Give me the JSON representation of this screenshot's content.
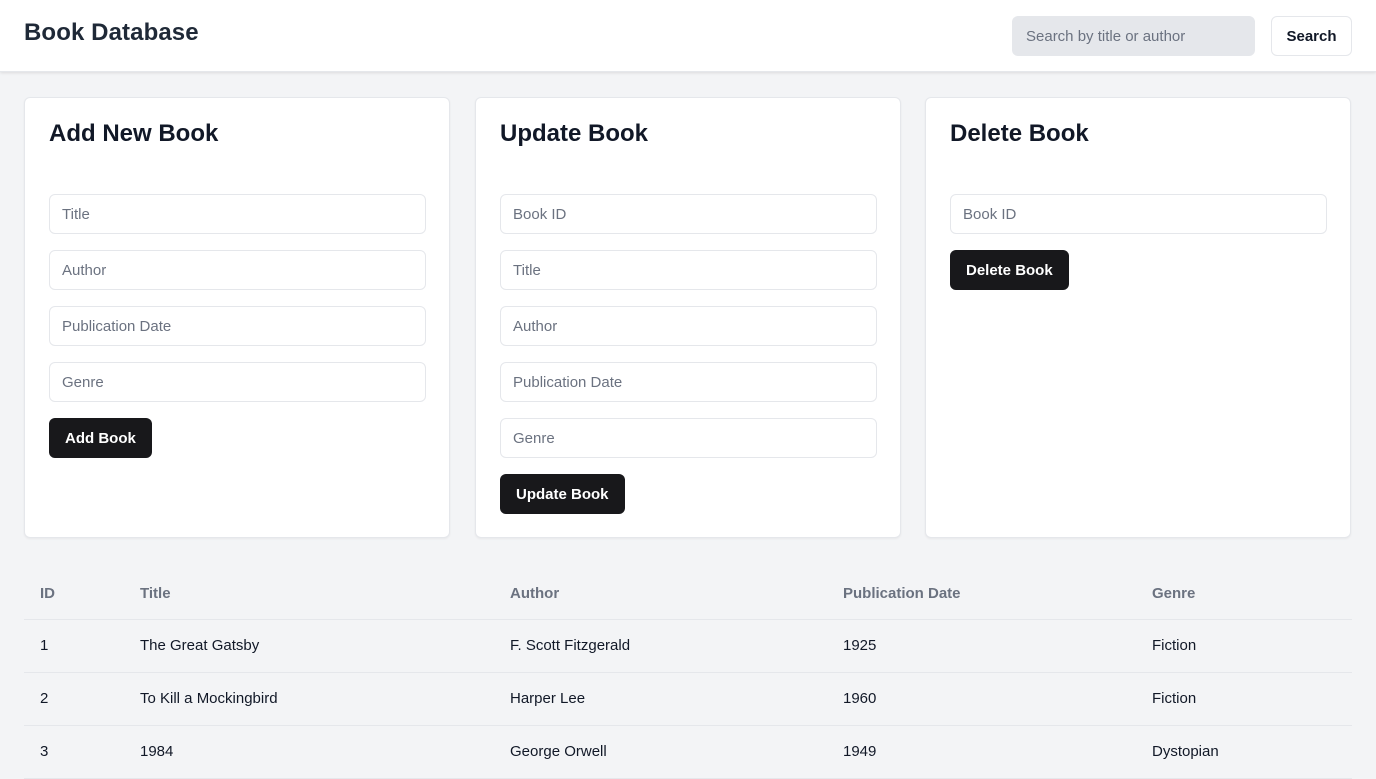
{
  "header": {
    "title": "Book Database",
    "search_placeholder": "Search by title or author",
    "search_value": "",
    "search_button": "Search"
  },
  "add_card": {
    "title": "Add New Book",
    "fields": {
      "title": "Title",
      "author": "Author",
      "publication_date": "Publication Date",
      "genre": "Genre"
    },
    "button": "Add Book"
  },
  "update_card": {
    "title": "Update Book",
    "fields": {
      "book_id": "Book ID",
      "title": "Title",
      "author": "Author",
      "publication_date": "Publication Date",
      "genre": "Genre"
    },
    "button": "Update Book"
  },
  "delete_card": {
    "title": "Delete Book",
    "fields": {
      "book_id": "Book ID"
    },
    "button": "Delete Book"
  },
  "table": {
    "columns": [
      "ID",
      "Title",
      "Author",
      "Publication Date",
      "Genre"
    ],
    "rows": [
      [
        "1",
        "The Great Gatsby",
        "F. Scott Fitzgerald",
        "1925",
        "Fiction"
      ],
      [
        "2",
        "To Kill a Mockingbird",
        "Harper Lee",
        "1960",
        "Fiction"
      ],
      [
        "3",
        "1984",
        "George Orwell",
        "1949",
        "Dystopian"
      ]
    ]
  },
  "colors": {
    "page_background": "#f3f4f6",
    "primary_button": "#18181b",
    "muted_text": "#6b7280",
    "border": "#e5e7eb"
  }
}
